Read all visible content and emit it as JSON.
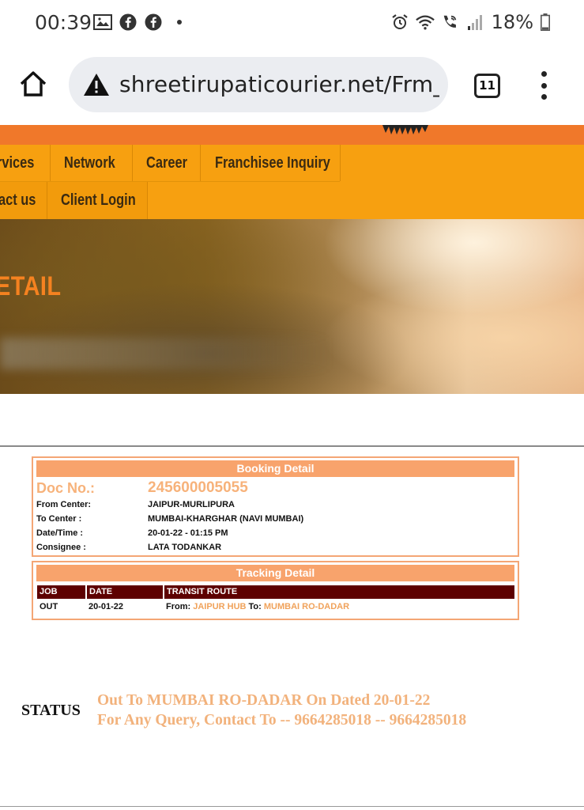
{
  "status_bar": {
    "time": "00:39",
    "battery": "18%",
    "left_icons": [
      "gallery-icon",
      "facebook-icon",
      "facebook-icon",
      "dot-icon"
    ],
    "right_icons": [
      "alarm-icon",
      "wifi-icon",
      "wifi-call-icon",
      "signal-icon",
      "battery-icon"
    ]
  },
  "browser": {
    "url": "shreetirupaticourier.net/Frm_",
    "tab_count": "11"
  },
  "nav": {
    "row1": [
      "rvices",
      "Network",
      "Career",
      "Franchisee Inquiry"
    ],
    "row2": [
      "act us",
      "Client Login"
    ]
  },
  "hero": {
    "title": "ETAIL"
  },
  "booking": {
    "heading": "Booking Detail",
    "doc_label": "Doc No.:",
    "doc_value": "245600005055",
    "fields": [
      {
        "label": "From Center:",
        "value": "JAIPUR-MURLIPURA"
      },
      {
        "label": "To Center :",
        "value": "MUMBAI-KHARGHAR (NAVI MUMBAI)"
      },
      {
        "label": "Date/Time :",
        "value": "20-01-22 - 01:15 PM"
      },
      {
        "label": "Consignee :",
        "value": "LATA TODANKAR"
      }
    ]
  },
  "tracking": {
    "heading": "Tracking Detail",
    "columns": [
      "JOB",
      "DATE",
      "TRANSIT ROUTE"
    ],
    "rows": [
      {
        "job": "OUT",
        "date": "20-01-22",
        "from_label": "From:",
        "from": "JAIPUR HUB",
        "to_label": "To:",
        "to": "MUMBAI RO-DADAR"
      }
    ]
  },
  "status": {
    "label": "STATUS",
    "line1": "Out To MUMBAI RO-DADAR On Dated 20-01-22",
    "line2": "For Any Query, Contact To -- 9664285018 -- 9664285018"
  },
  "colors": {
    "nav_bg": "#f7a010",
    "top_bar": "#f0782a",
    "panel_head": "#f8a36c",
    "table_head": "#5e0000",
    "accent_text": "#f2b27c"
  }
}
